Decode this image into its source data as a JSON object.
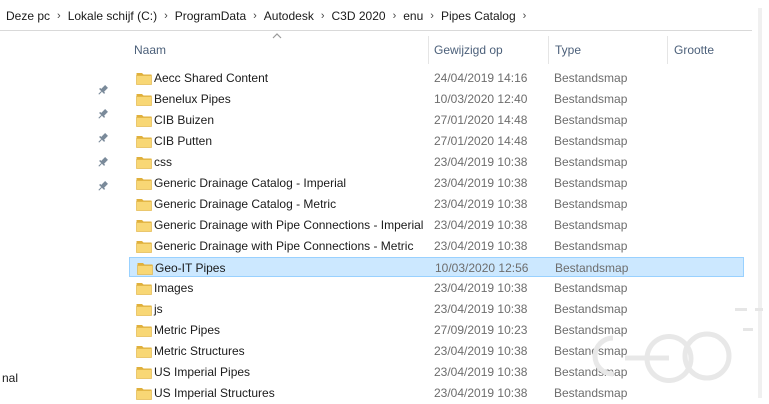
{
  "breadcrumb": [
    "Deze pc",
    "Lokale schijf (C:)",
    "ProgramData",
    "Autodesk",
    "C3D 2020",
    "enu",
    "Pipes Catalog"
  ],
  "columns": {
    "name": "Naam",
    "modified": "Gewijzigd op",
    "type": "Type",
    "size": "Grootte"
  },
  "nav_pane": {
    "pins": 5,
    "partial_text": "nal"
  },
  "rows": [
    {
      "name": "Aecc Shared Content",
      "modified": "24/04/2019 14:16",
      "type": "Bestandsmap",
      "selected": false
    },
    {
      "name": "Benelux Pipes",
      "modified": "10/03/2020 12:40",
      "type": "Bestandsmap",
      "selected": false
    },
    {
      "name": "CIB Buizen",
      "modified": "27/01/2020 14:48",
      "type": "Bestandsmap",
      "selected": false
    },
    {
      "name": "CIB Putten",
      "modified": "27/01/2020 14:48",
      "type": "Bestandsmap",
      "selected": false
    },
    {
      "name": "css",
      "modified": "23/04/2019 10:38",
      "type": "Bestandsmap",
      "selected": false
    },
    {
      "name": "Generic Drainage Catalog - Imperial",
      "modified": "23/04/2019 10:38",
      "type": "Bestandsmap",
      "selected": false
    },
    {
      "name": "Generic Drainage Catalog - Metric",
      "modified": "23/04/2019 10:38",
      "type": "Bestandsmap",
      "selected": false
    },
    {
      "name": "Generic Drainage with Pipe Connections - Imperial",
      "modified": "23/04/2019 10:38",
      "type": "Bestandsmap",
      "selected": false
    },
    {
      "name": "Generic Drainage with Pipe Connections - Metric",
      "modified": "23/04/2019 10:38",
      "type": "Bestandsmap",
      "selected": false
    },
    {
      "name": "Geo-IT Pipes",
      "modified": "10/03/2020 12:56",
      "type": "Bestandsmap",
      "selected": true
    },
    {
      "name": "Images",
      "modified": "23/04/2019 10:38",
      "type": "Bestandsmap",
      "selected": false
    },
    {
      "name": "js",
      "modified": "23/04/2019 10:38",
      "type": "Bestandsmap",
      "selected": false
    },
    {
      "name": "Metric Pipes",
      "modified": "27/09/2019 10:23",
      "type": "Bestandsmap",
      "selected": false
    },
    {
      "name": "Metric Structures",
      "modified": "23/04/2019 10:38",
      "type": "Bestandsmap",
      "selected": false
    },
    {
      "name": "US Imperial Pipes",
      "modified": "23/04/2019 10:38",
      "type": "Bestandsmap",
      "selected": false
    },
    {
      "name": "US Imperial Structures",
      "modified": "23/04/2019 10:38",
      "type": "Bestandsmap",
      "selected": false
    }
  ],
  "colors": {
    "folder": "#f8d775",
    "folder_dark": "#e0b03c",
    "selection": "#cce8ff",
    "selection_border": "#99d1ff",
    "header_text": "#4c607a"
  }
}
